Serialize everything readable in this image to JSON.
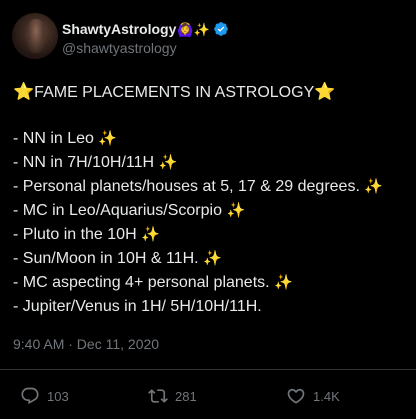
{
  "author": {
    "display_name": "ShawtyAstrology",
    "name_emojis": "🙆‍♀️✨",
    "handle": "@shawtyastrology",
    "verified": true
  },
  "tweet": {
    "headline_star": "⭐",
    "headline": "FAME PLACEMENTS IN ASTROLOGY",
    "lines": [
      {
        "text": "- NN in Leo ",
        "sparkle": "✨"
      },
      {
        "text": "- NN in 7H/10H/11H ",
        "sparkle": "✨"
      },
      {
        "text": "- Personal planets/houses at 5, 17 & 29 degrees. ",
        "sparkle": "✨"
      },
      {
        "text": "- MC in Leo/Aquarius/Scorpio ",
        "sparkle": "✨"
      },
      {
        "text": "- Pluto in the 10H ",
        "sparkle": "✨"
      },
      {
        "text": "- Sun/Moon in 10H & 11H. ",
        "sparkle": "✨"
      },
      {
        "text": "- MC aspecting 4+ personal planets. ",
        "sparkle": "✨"
      },
      {
        "text": "- Jupiter/Venus in 1H/ 5H/10H/11H.",
        "sparkle": ""
      }
    ],
    "timestamp": "9:40 AM · Dec 11, 2020"
  },
  "actions": {
    "replies": "103",
    "retweets": "281",
    "likes": "1.4K"
  },
  "colors": {
    "background": "#000000",
    "text": "#e7e9ea",
    "muted": "#71767b",
    "verified": "#1d9bf0",
    "divider": "#2f3336"
  },
  "icons": {
    "reply": "reply-icon",
    "retweet": "retweet-icon",
    "like": "heart-icon",
    "verified": "verified-badge-icon"
  }
}
